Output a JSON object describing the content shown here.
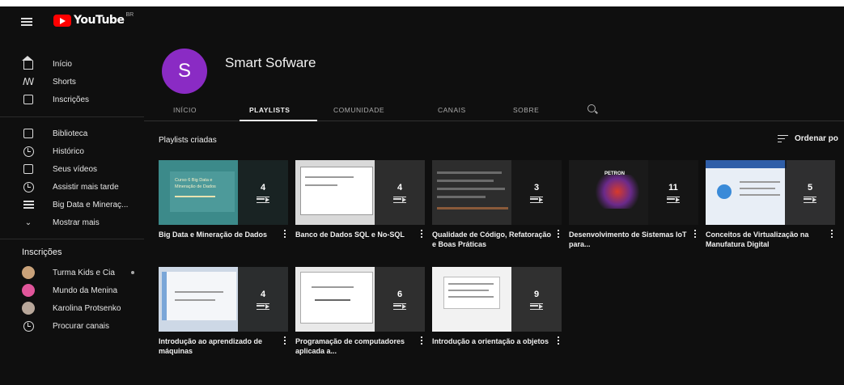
{
  "app": {
    "logo_text": "YouTube",
    "logo_badge": "BR"
  },
  "sidebar": {
    "main_items": [
      {
        "label": "Início",
        "icon": "home-icon"
      },
      {
        "label": "Shorts",
        "icon": "shorts-icon"
      },
      {
        "label": "Inscrições",
        "icon": "subscriptions-icon"
      }
    ],
    "library_items": [
      {
        "label": "Biblioteca",
        "icon": "library-icon"
      },
      {
        "label": "Histórico",
        "icon": "history-icon"
      },
      {
        "label": "Seus vídeos",
        "icon": "your-videos-icon"
      },
      {
        "label": "Assistir mais tarde",
        "icon": "watch-later-icon"
      },
      {
        "label": "Big Data e Mineraç...",
        "icon": "playlist-icon"
      },
      {
        "label": "Mostrar mais",
        "icon": "chevron-down-icon"
      }
    ],
    "subscriptions_heading": "Inscrições",
    "subscriptions": [
      {
        "label": "Turma Kids e Cia",
        "color": "#c9a27a"
      },
      {
        "label": "Mundo da Menina",
        "color": "#e0559a"
      },
      {
        "label": "Karolina Protsenko",
        "color": "#b8a79a"
      }
    ],
    "browse_channels": "Procurar canais"
  },
  "channel": {
    "avatar_letter": "S",
    "avatar_color": "#8a2bc4",
    "name": "Smart Sofware"
  },
  "tabs": [
    "INÍCIO",
    "PLAYLISTS",
    "COMUNIDADE",
    "CANAIS",
    "SOBRE"
  ],
  "active_tab": "PLAYLISTS",
  "section": {
    "title": "Playlists criadas",
    "sort_label": "Ordenar po"
  },
  "playlists": [
    {
      "title": "Big Data e Mineração de Dados",
      "count": "4"
    },
    {
      "title": "Banco de Dados SQL e No-SQL",
      "count": "4"
    },
    {
      "title": "Qualidade de Código, Refatoração e Boas Práticas",
      "count": "3"
    },
    {
      "title": "Desenvolvimento de Sistemas IoT para...",
      "count": "11"
    },
    {
      "title": "Conceitos de Virtualização na Manufatura Digital",
      "count": "5"
    },
    {
      "title": "Introdução ao aprendizado de máquinas",
      "count": "4"
    },
    {
      "title": "Programação de computadores aplicada a...",
      "count": "6"
    },
    {
      "title": "Introdução a orientação a objetos",
      "count": "9"
    }
  ],
  "thumb_texts": {
    "t1_line1": "Curso 6 Big Data e",
    "t1_line2": "Mineração de Dados",
    "t4_label": "PETRON"
  }
}
